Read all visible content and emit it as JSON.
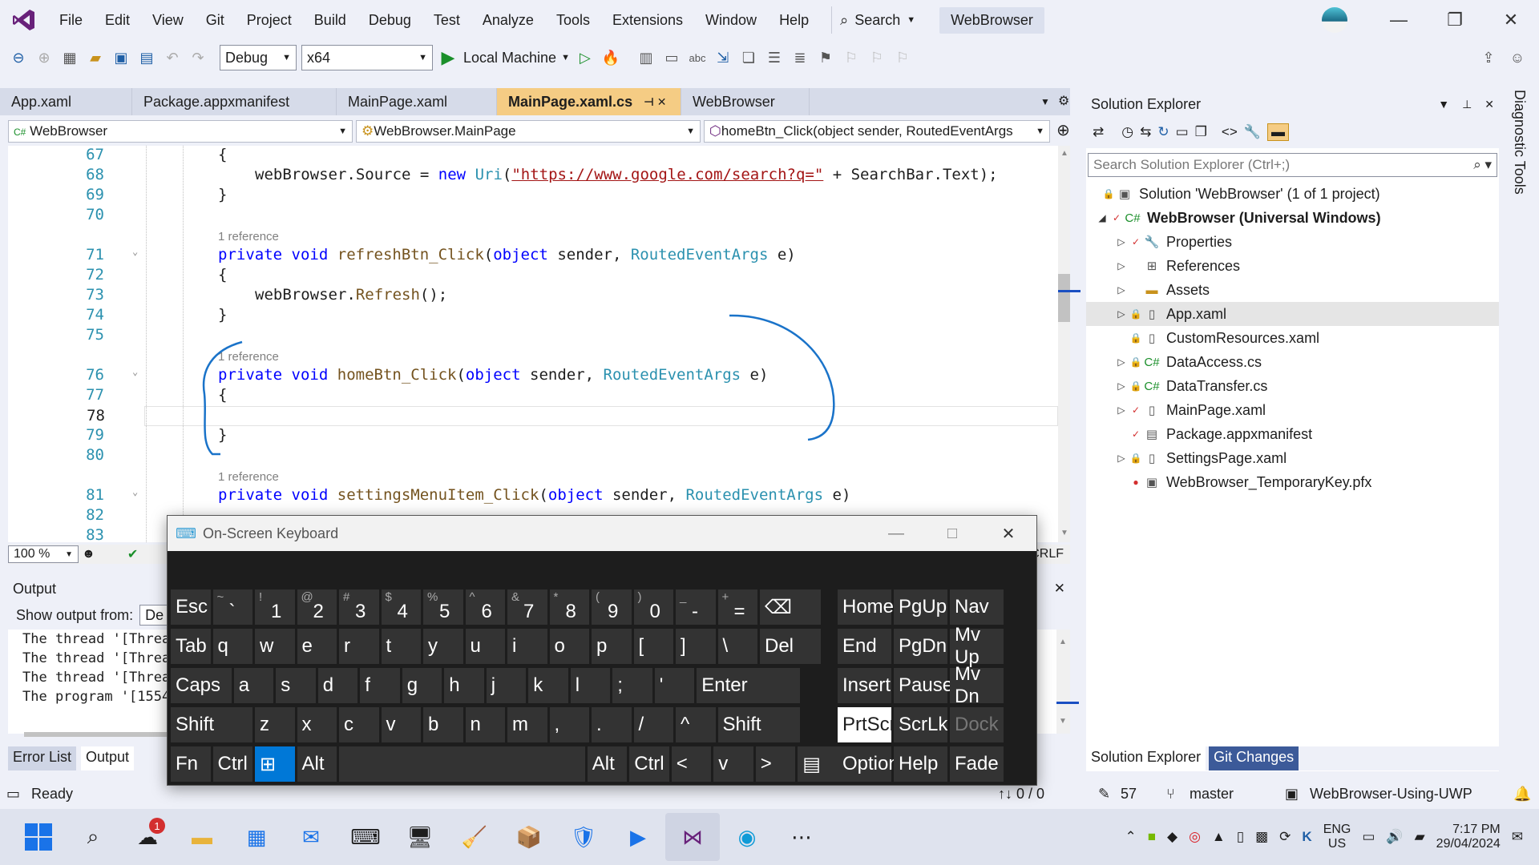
{
  "menu": [
    "File",
    "Edit",
    "View",
    "Git",
    "Project",
    "Build",
    "Debug",
    "Test",
    "Analyze",
    "Tools",
    "Extensions",
    "Window",
    "Help"
  ],
  "search_label": "Search",
  "title_badge": "WebBrowser",
  "toolbar": {
    "config": "Debug",
    "platform": "x64",
    "run_target": "Local Machine"
  },
  "tabs": [
    {
      "label": "App.xaml",
      "active": false
    },
    {
      "label": "Package.appxmanifest",
      "active": false
    },
    {
      "label": "MainPage.xaml",
      "active": false
    },
    {
      "label": "MainPage.xaml.cs",
      "active": true
    },
    {
      "label": "WebBrowser",
      "active": false
    }
  ],
  "nav": {
    "project": "WebBrowser",
    "class": "WebBrowser.MainPage",
    "member": "homeBtn_Click(object sender, RoutedEventArgs"
  },
  "code": {
    "l67": "67",
    "l68": "68",
    "l69": "69",
    "l70": "70",
    "l71": "71",
    "l72": "72",
    "l73": "73",
    "l74": "74",
    "l75": "75",
    "l76": "76",
    "l77": "77",
    "l78": "78",
    "l79": "79",
    "l80": "80",
    "l81": "81",
    "l82": "82",
    "l83": "83",
    "brace_open": "{",
    "brace_close": "}",
    "line68_a": "webBrowser.Source = ",
    "line68_new": "new",
    "line68_uri": "Uri",
    "line68_b": "(",
    "line68_str": "\"https://www.google.com/search?q=\"",
    "line68_c": " + SearchBar.Text);",
    "reference": "1 reference",
    "kw_private": "private",
    "kw_void": "void",
    "kw_object": "object",
    "t_routed": "RoutedEventArgs",
    "m_refresh": "refreshBtn_Click",
    "m_home": "homeBtn_Click",
    "m_settings": "settingsMenuItem_Click",
    "args": " sender, ",
    "arg_e": " e)",
    "paren": "(",
    "line73": "webBrowser.",
    "line73_m": "Refresh",
    "line73_end": "();"
  },
  "editor_status": {
    "zoom": "100 %",
    "eol": "CRLF"
  },
  "output": {
    "title": "Output",
    "show_from": "Show output from:",
    "source": "De",
    "lines": [
      "The thread '[Threa",
      "The thread '[Threa",
      "The thread '[Threa",
      "The program '[1554"
    ]
  },
  "bottom_tabs": [
    "Error List",
    "Output"
  ],
  "solution_explorer": {
    "title": "Solution Explorer",
    "search_placeholder": "Search Solution Explorer (Ctrl+;)",
    "solution": "Solution 'WebBrowser' (1 of 1 project)",
    "project": "WebBrowser (Universal Windows)",
    "items": [
      "Properties",
      "References",
      "Assets",
      "App.xaml",
      "CustomResources.xaml",
      "DataAccess.cs",
      "DataTransfer.cs",
      "MainPage.xaml",
      "Package.appxmanifest",
      "SettingsPage.xaml",
      "WebBrowser_TemporaryKey.pfx"
    ],
    "bottom_tabs": [
      "Solution Explorer",
      "Git Changes"
    ]
  },
  "diagnostic_tools": "Diagnostic Tools",
  "osk": {
    "title": "On-Screen Keyboard",
    "row1": [
      [
        "Esc",
        ""
      ],
      [
        "`",
        "~"
      ],
      [
        "1",
        "!"
      ],
      [
        "2",
        "@"
      ],
      [
        "3",
        "#"
      ],
      [
        "4",
        "$"
      ],
      [
        "5",
        "%"
      ],
      [
        "6",
        "^"
      ],
      [
        "7",
        "&"
      ],
      [
        "8",
        "*"
      ],
      [
        "9",
        "("
      ],
      [
        "0",
        ")"
      ],
      [
        "-",
        "_"
      ],
      [
        "=",
        "+"
      ],
      [
        "⌫",
        ""
      ]
    ],
    "row2": [
      "Tab",
      "q",
      "w",
      "e",
      "r",
      "t",
      "y",
      "u",
      "i",
      "o",
      "p",
      "[",
      "]",
      "\\",
      "Del"
    ],
    "row3": [
      "Caps",
      "a",
      "s",
      "d",
      "f",
      "g",
      "h",
      "j",
      "k",
      "l",
      ";",
      "'",
      "Enter"
    ],
    "row4": [
      "Shift",
      "z",
      "x",
      "c",
      "v",
      "b",
      "n",
      "m",
      ",",
      ".",
      "/",
      "^",
      "Shift"
    ],
    "row5": [
      "Fn",
      "Ctrl",
      "⊞",
      "Alt",
      "",
      "Alt",
      "Ctrl",
      "<",
      "v",
      ">",
      "▤"
    ],
    "right": [
      [
        "Home",
        "PgUp",
        "Nav"
      ],
      [
        "End",
        "PgDn",
        "Mv Up"
      ],
      [
        "Insert",
        "Pause",
        "Mv Dn"
      ],
      [
        "PrtScn",
        "ScrLk",
        "Dock"
      ],
      [
        "Options",
        "Help",
        "Fade"
      ]
    ]
  },
  "statusbar": {
    "ready": "Ready",
    "arrows": "↑↓ 0 / 0",
    "edits": "57",
    "branch": "master",
    "repo": "WebBrowser-Using-UWP"
  },
  "taskbar": {
    "lang": "ENG",
    "region": "US",
    "time": "7:17 PM",
    "date": "29/04/2024",
    "badge": "1"
  },
  "colors": {
    "accent": "#68217a",
    "tab_active": "#f5cc84",
    "keyword": "#0000ff",
    "type": "#2b91af",
    "annotation": "#1a73c9"
  }
}
